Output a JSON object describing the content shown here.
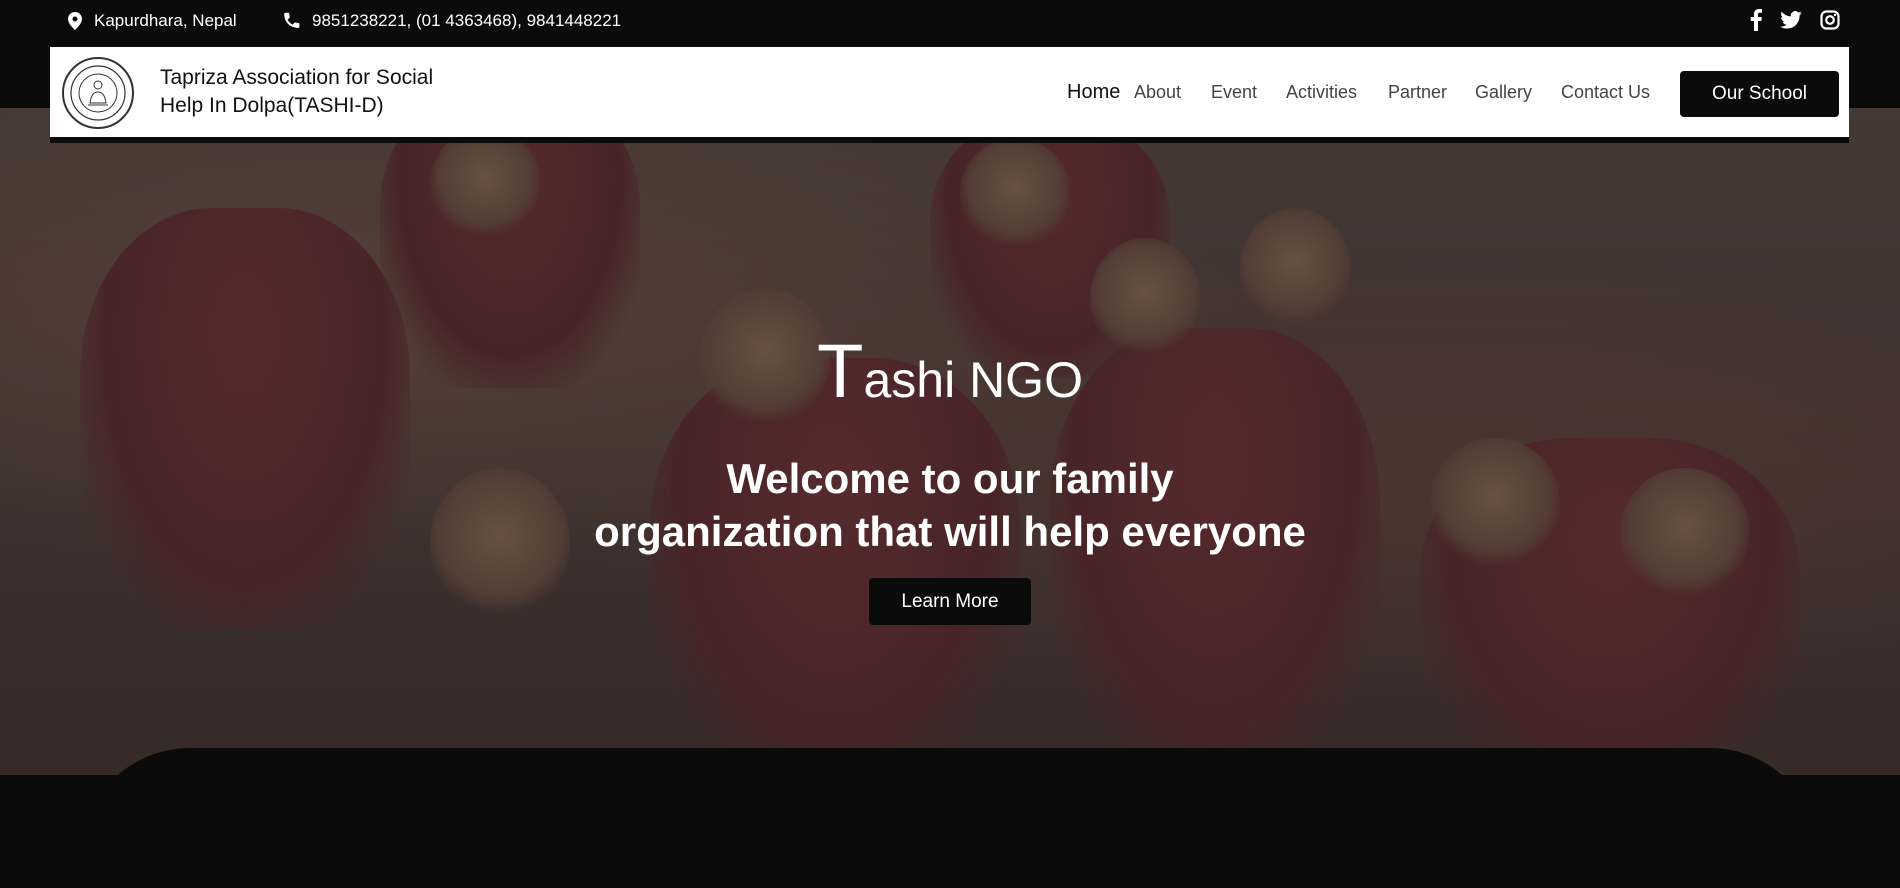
{
  "topbar": {
    "location": "Kapurdhara, Nepal",
    "phones": "9851238221, (01 4363468), 9841448221",
    "location_icon": "map-pin-icon",
    "phone_icon": "phone-icon",
    "social_icons": [
      "facebook-icon",
      "twitter-icon",
      "instagram-icon"
    ]
  },
  "header": {
    "brand_line1": "Tapriza Association for Social",
    "brand_line2": "Help In Dolpa(TASHI-D)",
    "nav": [
      {
        "label": "Home",
        "active": true
      },
      {
        "label": "About"
      },
      {
        "label": "Event"
      },
      {
        "label": "Activities"
      },
      {
        "label": "Partner"
      },
      {
        "label": "Gallery"
      },
      {
        "label": "Contact Us"
      }
    ],
    "cta_label": "Our School"
  },
  "hero": {
    "title_cap": "T",
    "title_rest": "ashi NGO",
    "subtitle_line1": "Welcome to our family",
    "subtitle_line2": "organization that will help everyone",
    "button_label": "Learn More"
  },
  "colors": {
    "dark": "#0b0b0c",
    "white": "#ffffff"
  }
}
